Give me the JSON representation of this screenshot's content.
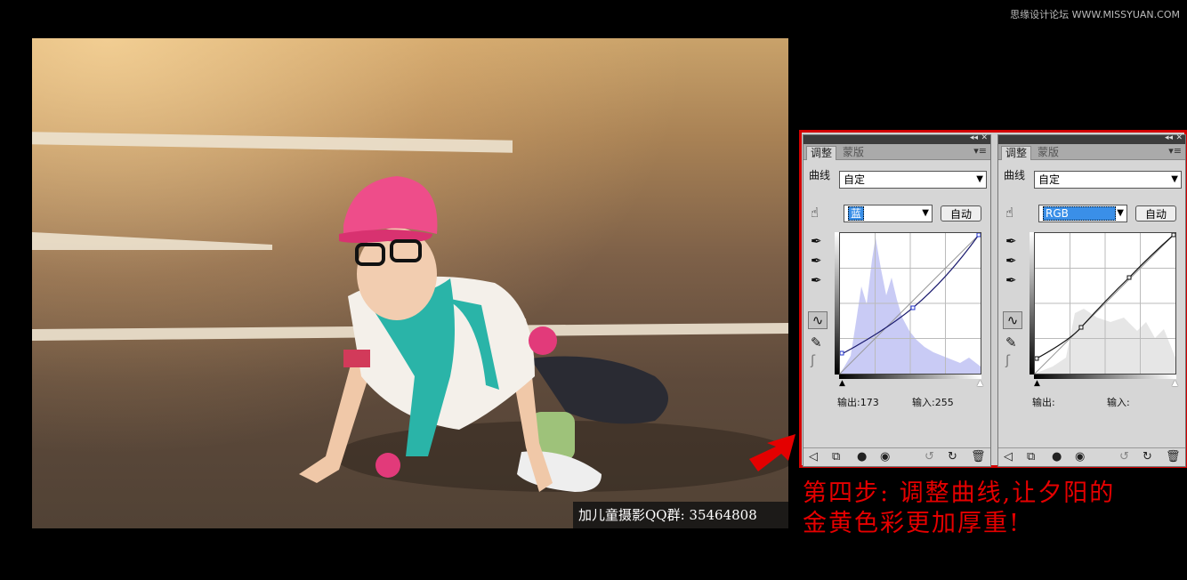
{
  "watermark": "思缘设计论坛 WWW.MISSYUAN.COM",
  "photo_caption": "加儿童摄影QQ群: 35464808",
  "panels": [
    {
      "tab_active": "调整",
      "tab_inactive": "蒙版",
      "label": "曲线",
      "preset": "自定",
      "channel": "蓝",
      "auto": "自动",
      "output_label": "输出:",
      "output_value": "173",
      "input_label": "输入:",
      "input_value": "255"
    },
    {
      "tab_active": "调整",
      "tab_inactive": "蒙版",
      "label": "曲线",
      "preset": "自定",
      "channel": "RGB",
      "auto": "自动",
      "output_label": "输出:",
      "output_value": "",
      "input_label": "输入:",
      "input_value": ""
    }
  ],
  "caption": {
    "line1": "第四步: 调整曲线,让夕阳的",
    "line2": "金黄色彩更加厚重!"
  },
  "colors": {
    "frame": "#d30000",
    "caption": "#e60000",
    "highlight": "#3a8fe8"
  }
}
